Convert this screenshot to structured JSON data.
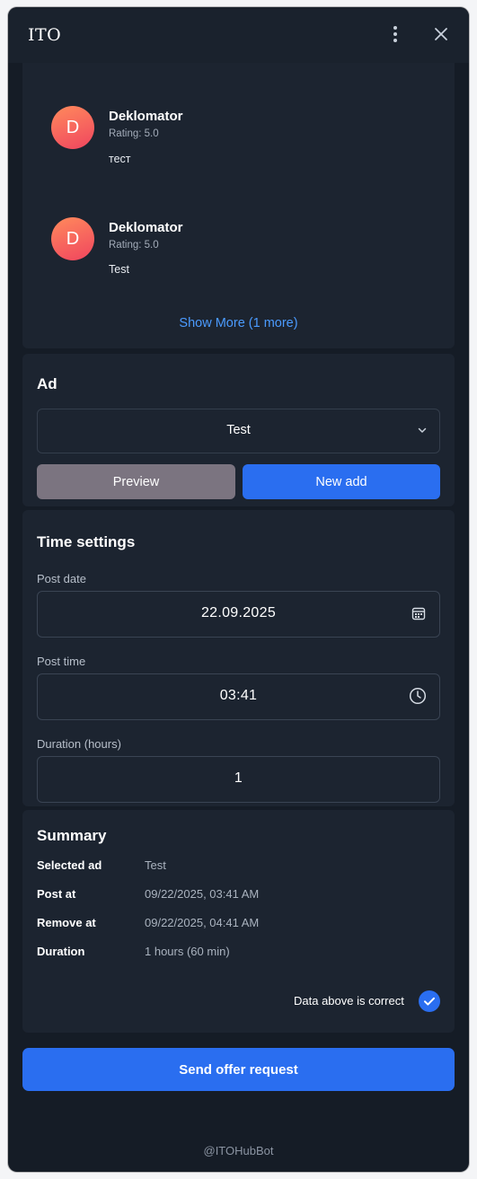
{
  "window": {
    "title": "ITO"
  },
  "reviews": {
    "items": [
      {
        "initial": "D",
        "name": "Deklomator",
        "rating": "Rating: 5.0",
        "text": "тест"
      },
      {
        "initial": "D",
        "name": "Deklomator",
        "rating": "Rating: 5.0",
        "text": "Test"
      }
    ],
    "show_more": "Show More (1 more)"
  },
  "ad": {
    "title": "Ad",
    "selected": "Test",
    "preview_label": "Preview",
    "new_label": "New add"
  },
  "time_settings": {
    "title": "Time settings",
    "post_date_label": "Post date",
    "post_date": "22.09.2025",
    "post_time_label": "Post time",
    "post_time": "03:41",
    "duration_label": "Duration (hours)",
    "duration": "1"
  },
  "summary": {
    "title": "Summary",
    "rows": [
      {
        "key": "Selected ad",
        "value": "Test"
      },
      {
        "key": "Post at",
        "value": "09/22/2025, 03:41 AM"
      },
      {
        "key": "Remove at",
        "value": "09/22/2025, 04:41 AM"
      },
      {
        "key": "Duration",
        "value": "1 hours (60 min)"
      }
    ],
    "confirm_label": "Data above is correct",
    "confirm_checked": true
  },
  "send_label": "Send offer request",
  "footer": "@ITOHubBot",
  "colors": {
    "accent": "#2a6ef0",
    "link": "#4b9bff",
    "background": "#151c26",
    "card": "#1c2430"
  },
  "icons": [
    "more-vertical-icon",
    "close-icon",
    "chevron-down-icon",
    "calendar-icon",
    "clock-icon",
    "check-icon"
  ]
}
